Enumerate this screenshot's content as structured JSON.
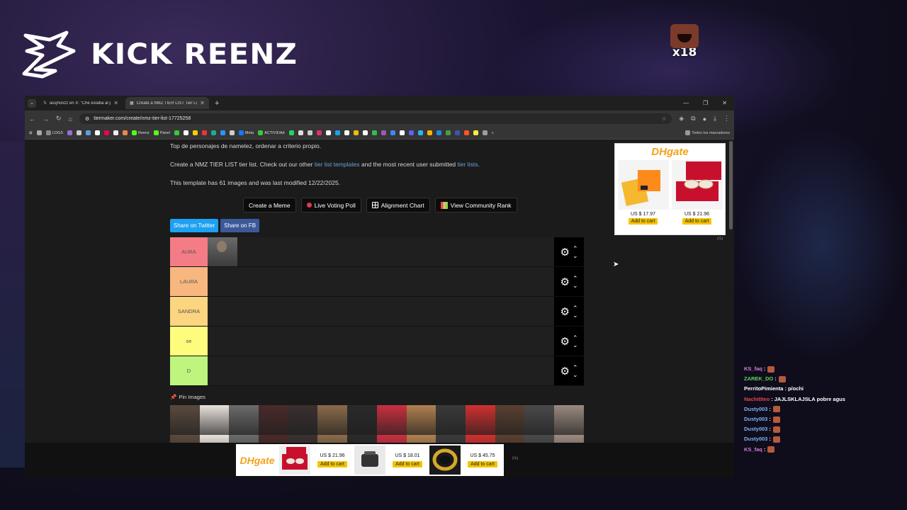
{
  "stream": {
    "logo_text": "KICK REENZ",
    "emote_count": "x18"
  },
  "browser": {
    "tabs": [
      {
        "title": "assjhoxzz en X: \"Che estaba al p",
        "active": false
      },
      {
        "title": "Create a NMZ TIER LIST Tier Lis",
        "active": true
      }
    ],
    "url": "tiermaker.com/create/nmz-tier-list-17725258",
    "bookmarks": [
      "LOGS",
      "Reenz",
      "Panel",
      "Meta",
      "ACTIVIDAd"
    ],
    "bookmarks_right": "Todos los marcadores"
  },
  "page": {
    "desc": "Top de personajes de namelez, ordenar a criterio propio.",
    "create_prefix": "Create a NMZ TIER LIST tier list. Check out our other ",
    "templates_link": "tier list templates",
    "create_mid": " and the most recent user submitted ",
    "lists_link": "tier lists",
    "create_suffix": ".",
    "template_info": "This template has 61 images and was last modified 12/22/2025.",
    "buttons": {
      "meme": "Create a Meme",
      "poll": "Live Voting Poll",
      "alignment": "Alignment Chart",
      "community": "View Community Rank"
    },
    "share_twitter": "Share on Twitter",
    "share_fb": "Share on FB",
    "tiers": [
      {
        "label": "AURA",
        "color": "#f47c86"
      },
      {
        "label": "LAURA",
        "color": "#f7b77e"
      },
      {
        "label": "SANDRA",
        "color": "#fbd580"
      },
      {
        "label": "se",
        "color": "#fdfc7d"
      },
      {
        "label": "D",
        "color": "#bff47e"
      }
    ],
    "pin_label": "Pin Images"
  },
  "ads": {
    "side_brand": "DHgate",
    "side_products": [
      {
        "price": "US $ 17.97",
        "cart": "Add to cart"
      },
      {
        "price": "US $ 21.96",
        "cart": "Add to cart"
      }
    ],
    "pn": "PN",
    "bottom_brand": "DHgate",
    "bottom_products": [
      {
        "price": "US $ 21.96",
        "cart": "Add to cart"
      },
      {
        "price": "US $ 18.01",
        "cart": "Add to cart"
      },
      {
        "price": "US $ 45.75",
        "cart": "Add to cart"
      }
    ]
  },
  "chat": [
    {
      "user": "KS_faq",
      "color": "#d47ad8",
      "msg": "",
      "emote": true
    },
    {
      "user": "ZAREK_DO",
      "color": "#5dd65d",
      "msg": "",
      "emote": true
    },
    {
      "user": "PerritoPimienta",
      "color": "#ffffff",
      "msg": "p/ochi",
      "emote": false
    },
    {
      "user": "NachitIteo",
      "color": "#e04848",
      "msg": "JAJLSKLAJSLA pobre agus",
      "emote": false
    },
    {
      "user": "Dusty003",
      "color": "#7fb3f5",
      "msg": "",
      "emote": true
    },
    {
      "user": "Dusty003",
      "color": "#7fb3f5",
      "msg": "",
      "emote": true
    },
    {
      "user": "Dusty003",
      "color": "#7fb3f5",
      "msg": "",
      "emote": true
    },
    {
      "user": "Dusty003",
      "color": "#7fb3f5",
      "msg": "",
      "emote": true
    },
    {
      "user": "KS_faq",
      "color": "#d47ad8",
      "msg": "",
      "emote": true
    }
  ]
}
